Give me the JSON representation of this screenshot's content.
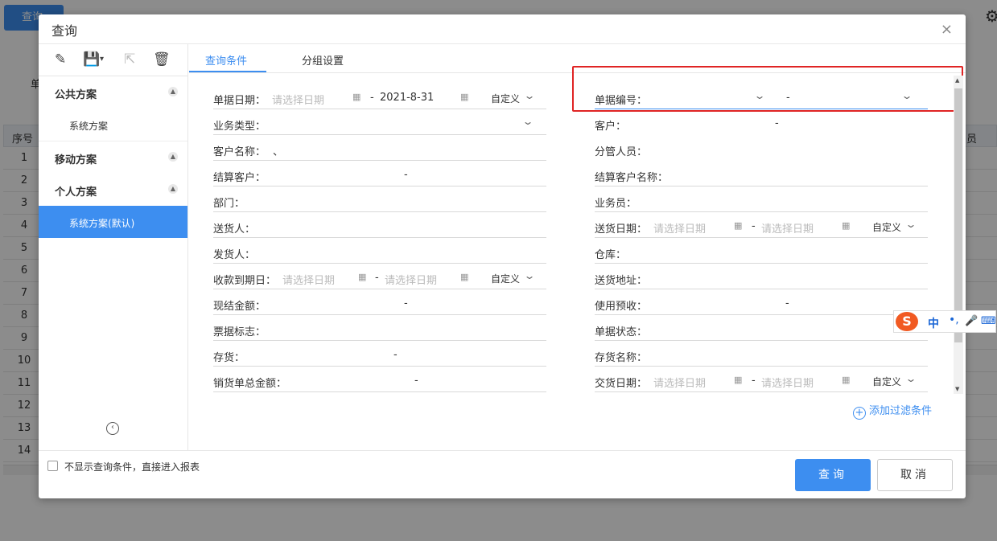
{
  "background": {
    "query_button": "查询",
    "side_label": "单",
    "table_header_first": "序号",
    "table_header_last": "员",
    "rows": [
      "1",
      "2",
      "3",
      "4",
      "5",
      "6",
      "7",
      "8",
      "9",
      "10",
      "11",
      "12",
      "13",
      "14"
    ]
  },
  "dialog": {
    "title": "查询",
    "close": "×",
    "left_panel": {
      "groups": [
        {
          "label": "公共方案",
          "items": [
            "系统方案"
          ]
        },
        {
          "label": "移动方案",
          "items": []
        },
        {
          "label": "个人方案",
          "items": [
            "系统方案(默认)"
          ]
        }
      ],
      "active_item": "系统方案(默认)"
    },
    "tabs": [
      "查询条件",
      "分组设置"
    ],
    "fields": {
      "doc_date": {
        "label": "单据日期：",
        "placeholder": "请选择日期",
        "to_value": "2021-8-31",
        "custom": "自定义"
      },
      "biz_type": {
        "label": "业务类型："
      },
      "cust_name": {
        "label": "客户名称：",
        "value": "、"
      },
      "settle_cust": {
        "label": "结算客户："
      },
      "dept": {
        "label": "部门："
      },
      "deliverer": {
        "label": "送货人："
      },
      "shipper": {
        "label": "发货人："
      },
      "due_date": {
        "label": "收款到期日：",
        "placeholder": "请选择日期",
        "placeholder2": "请选择日期",
        "custom": "自定义"
      },
      "cash_amount": {
        "label": "现结金额："
      },
      "bill_flag": {
        "label": "票据标志："
      },
      "inventory": {
        "label": "存货："
      },
      "sales_total": {
        "label": "销货单总金额："
      },
      "doc_no": {
        "label": "单据编号："
      },
      "customer": {
        "label": "客户："
      },
      "manager": {
        "label": "分管人员："
      },
      "settle_cust_name": {
        "label": "结算客户名称："
      },
      "salesman": {
        "label": "业务员："
      },
      "delivery_date": {
        "label": "送货日期：",
        "placeholder": "请选择日期",
        "placeholder2": "请选择日期",
        "custom": "自定义"
      },
      "warehouse": {
        "label": "仓库："
      },
      "delivery_addr": {
        "label": "送货地址："
      },
      "use_prepay": {
        "label": "使用预收："
      },
      "doc_status": {
        "label": "单据状态："
      },
      "inv_name": {
        "label": "存货名称："
      },
      "handover_date": {
        "label": "交货日期：",
        "placeholder": "请选择日期",
        "placeholder2": "请选择日期",
        "custom": "自定义"
      }
    },
    "dash": "-",
    "add_filter": "添加过滤条件",
    "checkbox_label": "不显示查询条件，直接进入报表",
    "buttons": {
      "query": "查询",
      "cancel": "取消"
    },
    "ime": {
      "lang": "中",
      "punct": "•,",
      "mic": "🎤",
      "kbd": "⌨"
    }
  }
}
